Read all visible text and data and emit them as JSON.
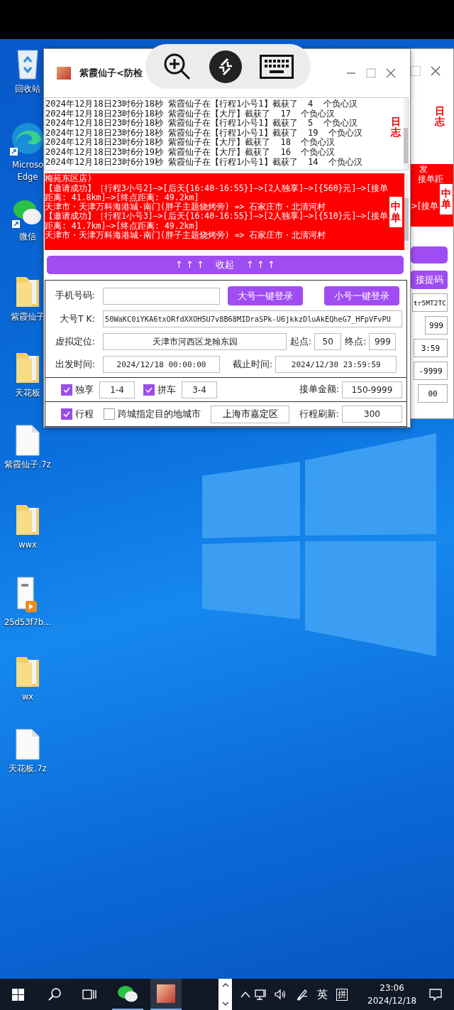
{
  "desktop": {
    "icons": [
      {
        "kind": "recycle",
        "label": "回收站"
      },
      {
        "kind": "edge",
        "label": "Microso\nEdge"
      },
      {
        "kind": "wechat",
        "label": "微信"
      },
      {
        "kind": "folder",
        "label": "紫霞仙子"
      },
      {
        "kind": "folder",
        "label": "天花板"
      },
      {
        "kind": "file",
        "label": "紫霞仙子.7z"
      },
      {
        "kind": "folder",
        "label": "wwx"
      },
      {
        "kind": "video",
        "label": "25d53f7b..."
      },
      {
        "kind": "folder",
        "label": "wx"
      },
      {
        "kind": "file",
        "label": "天花板.7z"
      }
    ]
  },
  "back_window": {
    "log_label": "日志",
    "order_texts": [
      "发",
      "接单距",
      ">[接单"
    ],
    "order_label": "中单",
    "code_button": "接提码",
    "fields": [
      "tr5MT2TC",
      "999",
      "3:59",
      "-9999",
      "00"
    ]
  },
  "main_window": {
    "title": "紫霞仙子<防检",
    "log": {
      "side_label": "日志",
      "lines": [
        "2024年12月18日23时6分18秒 紫霞仙子在【行程1小号1】截获了  4  个负心汉",
        "2024年12月18日23时6分18秒 紫霞仙子在【大厅】截获了  17  个负心汉",
        "2024年12月18日23时6分18秒 紫霞仙子在【行程1小号1】截获了  5  个负心汉",
        "2024年12月18日23时6分18秒 紫霞仙子在【行程1小号1】截获了  19  个负心汉",
        "2024年12月18日23时6分18秒 紫霞仙子在【大厅】截获了  18  个负心汉",
        "2024年12月18日23时6分19秒 紫霞仙子在【大厅】截获了  16  个负心汉",
        "2024年12月18日23时6分19秒 紫霞仙子在【行程1小号1】截获了  14  个负心汉"
      ]
    },
    "orders": {
      "side_label": "中单",
      "lines": [
        "梅苑东区店)",
        "【邀请成功】［行程3小号2]—>[后天{16:40-16:55}]—>[2人独享]—>[{560}元]—>[接单距离: 41.8km]—>[终点距离: 49.2km]",
        "天津市・天津万科海港城-南门(胖子主题烧烤旁) => 石家庄市・北清河村",
        "【邀请成功】［行程1小号3]—>[后天{16:40-16:55}]—>[2人独享]—>[{510}元]—>[接单距离: 41.7km]—>[终点距离: 49.2km]",
        "天津市・天津万科海港城-南门(胖子主题烧烤旁) => 石家庄市・北清河村"
      ]
    },
    "collapse_button": "↑ ↑ ↑    收起    ↑ ↑ ↑",
    "form": {
      "phone": {
        "label": "手机号码:"
      },
      "login_buttons": [
        "大号一键登录",
        "小号一键登录"
      ],
      "token": {
        "label": "大号T K:",
        "value": "50WaKC0iYKA6txORfdXXOH5U7v8B68MIDraSPk-U6jkkzDluAkEQheG7_HFpVFvPU"
      },
      "location": {
        "label": "虚拟定位:",
        "value": "天津市河西区龙翰东园"
      },
      "start_point": {
        "label": "起点:",
        "value": "50"
      },
      "end_point": {
        "label": "终点:",
        "value": "999"
      },
      "depart_time": {
        "label": "出发时间:",
        "value": "2024/12/18 00:00:00"
      },
      "deadline": {
        "label": "截止时间:",
        "value": "2024/12/30 23:59:59"
      },
      "options": [
        {
          "label": "独享",
          "checked": true,
          "value": "1-4"
        },
        {
          "label": "拼车",
          "checked": true,
          "value": "3-4"
        }
      ],
      "amount": {
        "label": "接单金额:",
        "value": "150-9999"
      },
      "trip": {
        "label": "行程",
        "checked": true
      },
      "cross_city": {
        "label": "跨城指定目的地城市",
        "checked": false
      },
      "city_button": "上海市嘉定区",
      "refresh": {
        "label": "行程刷新:",
        "value": "300"
      }
    }
  },
  "taskbar": {
    "ime_mode": "英",
    "ime_name": "拼",
    "time": "23:06",
    "date": "2024/12/18"
  }
}
